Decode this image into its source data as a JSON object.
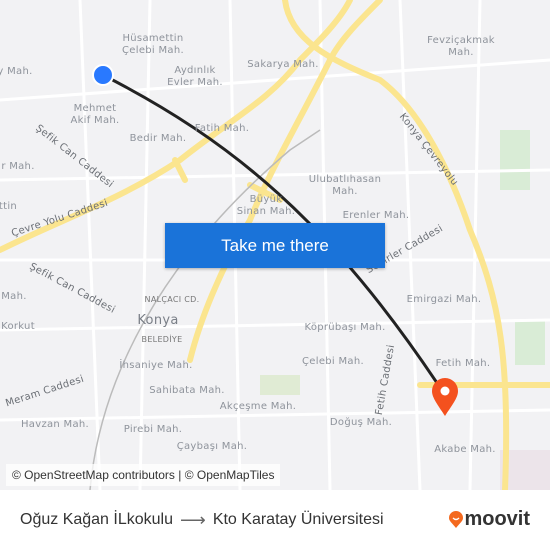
{
  "map": {
    "labels": [
      "Hüsamettin",
      "Çelebi Mah.",
      "Aydınlık",
      "Evler Mah.",
      "Sakarya Mah.",
      "Fevziçakmak",
      "Mah.",
      "Mehmet",
      "Akif Mah.",
      "Bedir Mah.",
      "Fatih Mah.",
      "Şefik Can Caddesi",
      "Çevre Yolu Caddesi",
      "Ulubatlıhasan",
      "Mah.",
      "Büyük",
      "Sinan Mah.",
      "Erenler Mah.",
      "Konya Çevreyolu",
      "Sedirler Caddesi",
      "Şefik Can Caddesi",
      "Emirgazi Mah.",
      "NALÇACI CD.",
      "Konya",
      "BELEDİYE",
      "Köprübaşı Mah.",
      "Korkut",
      "Çelebi Mah.",
      "Fetih Caddesi",
      "Fetih Mah.",
      "İhsaniye Mah.",
      "Sahibata Mah.",
      "Akçeşme Mah.",
      "Meram Caddesi",
      "Havzan Mah.",
      "Pirebi Mah.",
      "Doğuş Mah.",
      "Çaybaşı Mah.",
      "Akabe Mah.",
      "y Mah.",
      "r Mah.",
      "ttin",
      "Mah."
    ],
    "origin_color": "#2979ff",
    "destination_color": "#f4511e",
    "route_color": "#222222",
    "major_road_color": "#fbe58f"
  },
  "cta": {
    "label": "Take me there"
  },
  "attribution": "© OpenStreetMap contributors | © OpenMapTiles",
  "footer": {
    "origin": "Oğuz Kağan İLkokulu",
    "arrow": "⟶",
    "destination": "Kto Karatay Üniversitesi",
    "brand": "moovit"
  }
}
